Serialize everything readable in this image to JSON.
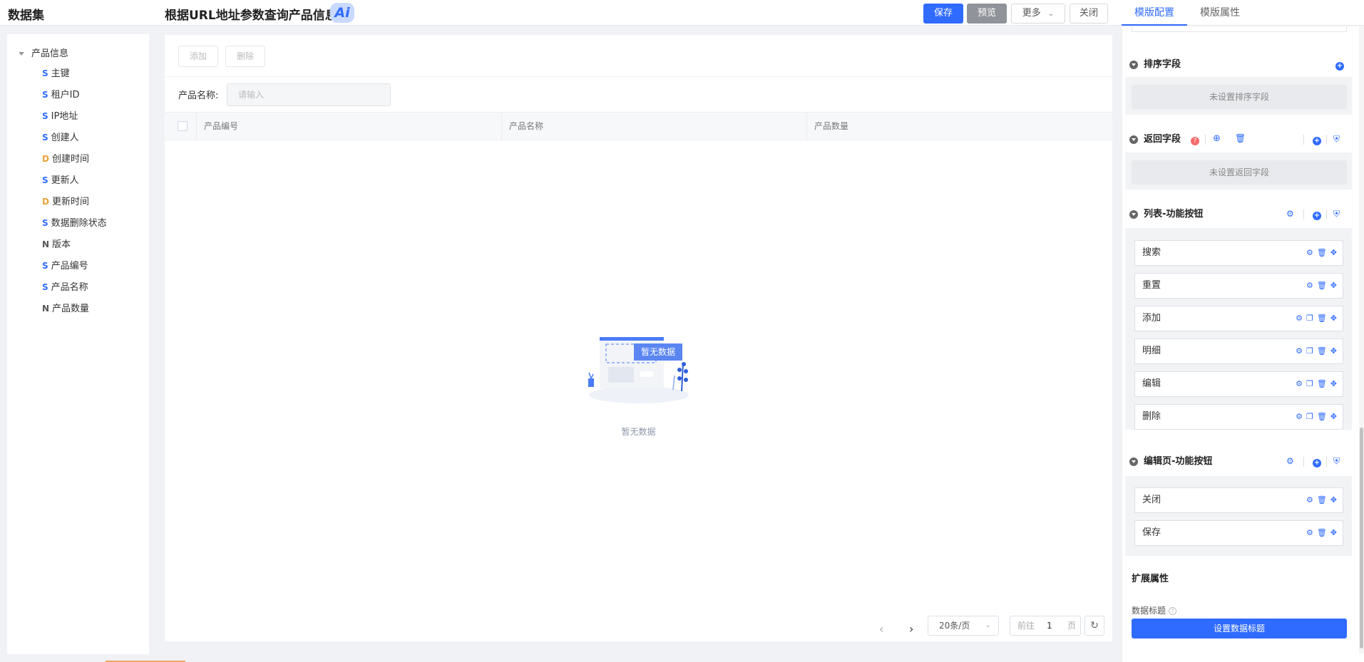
{
  "header": {
    "app_title": "数据集",
    "page_title": "根据URL地址参数查询产品信息",
    "ai_badge": "Ai",
    "save": "保存",
    "preview": "预览",
    "more": "更多",
    "close": "关闭"
  },
  "right_tabs": [
    "模版配置",
    "模版属性"
  ],
  "tree": {
    "root": "产品信息",
    "items": [
      {
        "type": "S",
        "label": "主键",
        "color": "#2f6bff"
      },
      {
        "type": "S",
        "label": "租户ID",
        "color": "#2f6bff"
      },
      {
        "type": "S",
        "label": "IP地址",
        "color": "#2f6bff"
      },
      {
        "type": "S",
        "label": "创建人",
        "color": "#2f6bff"
      },
      {
        "type": "D",
        "label": "创建时间",
        "color": "#e6a23c"
      },
      {
        "type": "S",
        "label": "更新人",
        "color": "#2f6bff"
      },
      {
        "type": "D",
        "label": "更新时间",
        "color": "#e6a23c"
      },
      {
        "type": "S",
        "label": "数据删除状态",
        "color": "#2f6bff"
      },
      {
        "type": "N",
        "label": "版本",
        "color": "#555555"
      },
      {
        "type": "S",
        "label": "产品编号",
        "color": "#2f6bff"
      },
      {
        "type": "S",
        "label": "产品名称",
        "color": "#2f6bff"
      },
      {
        "type": "N",
        "label": "产品数量",
        "color": "#555555"
      }
    ]
  },
  "main": {
    "toolbar": {
      "add": "添加",
      "delete": "删除"
    },
    "filter": {
      "label": "产品名称:",
      "placeholder": "请输入"
    },
    "columns": [
      "产品编号",
      "产品名称",
      "产品数量"
    ],
    "empty_badge": "暂无数据",
    "empty_text": "暂无数据",
    "pager": {
      "page_size": "20条/页",
      "goto_prefix": "前往",
      "page": "1",
      "goto_suffix": "页"
    }
  },
  "config": {
    "sort": {
      "title": "排序字段",
      "empty": "未设置排序字段"
    },
    "return": {
      "title": "返回字段",
      "empty": "未设置返回字段"
    },
    "list_buttons": {
      "title": "列表-功能按钮",
      "items": [
        "搜索",
        "重置",
        "添加",
        "明细",
        "编辑",
        "删除"
      ]
    },
    "edit_buttons": {
      "title": "编辑页-功能按钮",
      "items": [
        "关闭",
        "保存"
      ]
    },
    "extension": {
      "title": "扩展属性",
      "data_title_label": "数据标题",
      "set_button": "设置数据标题"
    }
  },
  "colors": {
    "accent": "#2f6bff",
    "grey_button": "#909399",
    "warning": "#e6a23c",
    "danger": "#f56c6c"
  }
}
